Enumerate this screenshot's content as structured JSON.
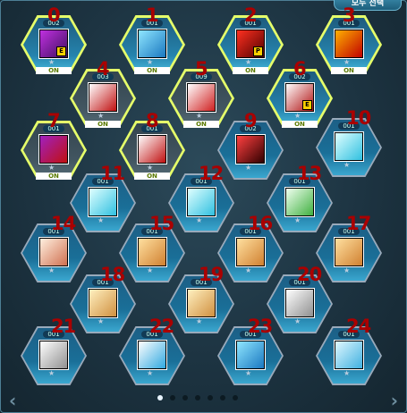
{
  "header": {
    "select_all": "모두 선택"
  },
  "on_label": "ON",
  "skills": [
    {
      "num": "0",
      "count": "002",
      "on": true,
      "icon": "purple-cross-e",
      "colors": [
        "#c030e0",
        "#401060"
      ],
      "tag": "E"
    },
    {
      "num": "1",
      "count": "001",
      "on": true,
      "icon": "blue-target",
      "colors": [
        "#8fe6ff",
        "#1a78c0"
      ]
    },
    {
      "num": "2",
      "count": "001",
      "on": true,
      "icon": "red-stripe-p",
      "colors": [
        "#ff3020",
        "#500000"
      ],
      "tag": "P"
    },
    {
      "num": "3",
      "count": "001",
      "on": true,
      "icon": "red-dragon",
      "colors": [
        "#ffb000",
        "#c00000"
      ]
    },
    {
      "num": "4",
      "count": "003",
      "on": true,
      "dim": true,
      "icon": "red-black-shield",
      "colors": [
        "#ffffff",
        "#c01010"
      ]
    },
    {
      "num": "5",
      "count": "009",
      "on": true,
      "dim": true,
      "icon": "red-black-slash",
      "colors": [
        "#ffffff",
        "#d02020"
      ]
    },
    {
      "num": "6",
      "count": "002",
      "on": true,
      "icon": "black-slash-e",
      "colors": [
        "#ffffff",
        "#b01010"
      ],
      "tag": "E"
    },
    {
      "num": "7",
      "count": "001",
      "on": true,
      "dim": true,
      "icon": "purple-red-shield",
      "colors": [
        "#a020c0",
        "#c01010"
      ]
    },
    {
      "num": "8",
      "count": "001",
      "on": true,
      "dim": true,
      "icon": "red-black-cross",
      "colors": [
        "#ffffff",
        "#c01010"
      ]
    },
    {
      "num": "9",
      "count": "002",
      "on": false,
      "icon": "red-web",
      "colors": [
        "#ff4040",
        "#300000"
      ]
    },
    {
      "num": "10",
      "count": "001",
      "on": false,
      "icon": "cyan-wings",
      "colors": [
        "#e0ffff",
        "#30c0e0"
      ]
    },
    {
      "num": "11",
      "count": "001",
      "on": false,
      "icon": "cyan-wings",
      "colors": [
        "#e0ffff",
        "#30c0e0"
      ]
    },
    {
      "num": "12",
      "count": "001",
      "on": false,
      "icon": "cyan-wings",
      "colors": [
        "#e0ffff",
        "#30c0e0"
      ]
    },
    {
      "num": "13",
      "count": "001",
      "on": false,
      "icon": "green-eye",
      "colors": [
        "#f0fff0",
        "#40b040"
      ]
    },
    {
      "num": "14",
      "count": "001",
      "on": false,
      "icon": "orange-totem",
      "colors": [
        "#fff0e0",
        "#d07050"
      ]
    },
    {
      "num": "15",
      "count": "001",
      "on": false,
      "icon": "gold-burst",
      "colors": [
        "#ffe0a0",
        "#d08030"
      ]
    },
    {
      "num": "16",
      "count": "001",
      "on": false,
      "icon": "gold-burst",
      "colors": [
        "#ffe0a0",
        "#d08030"
      ]
    },
    {
      "num": "17",
      "count": "001",
      "on": false,
      "icon": "gold-burst",
      "colors": [
        "#ffe0a0",
        "#d08030"
      ]
    },
    {
      "num": "18",
      "count": "001",
      "on": false,
      "icon": "gold-fountain",
      "colors": [
        "#fff0c0",
        "#d09040"
      ]
    },
    {
      "num": "19",
      "count": "001",
      "on": false,
      "icon": "gold-fountain",
      "colors": [
        "#fff0c0",
        "#d09040"
      ]
    },
    {
      "num": "20",
      "count": "001",
      "on": false,
      "icon": "grey-party-plus",
      "colors": [
        "#ffffff",
        "#909090"
      ]
    },
    {
      "num": "21",
      "count": "001",
      "on": false,
      "icon": "grey-party-plus",
      "colors": [
        "#ffffff",
        "#909090"
      ]
    },
    {
      "num": "22",
      "count": "001",
      "on": false,
      "icon": "blue-runner",
      "colors": [
        "#ffffff",
        "#30a8e0"
      ]
    },
    {
      "num": "23",
      "count": "001",
      "on": false,
      "icon": "blue-target",
      "colors": [
        "#8fe6ff",
        "#1a78c0"
      ]
    },
    {
      "num": "24",
      "count": "001",
      "on": false,
      "icon": "blue-lotus",
      "colors": [
        "#e0f8ff",
        "#40b0e0"
      ]
    }
  ],
  "pagination": {
    "pages": 7,
    "current": 1
  }
}
